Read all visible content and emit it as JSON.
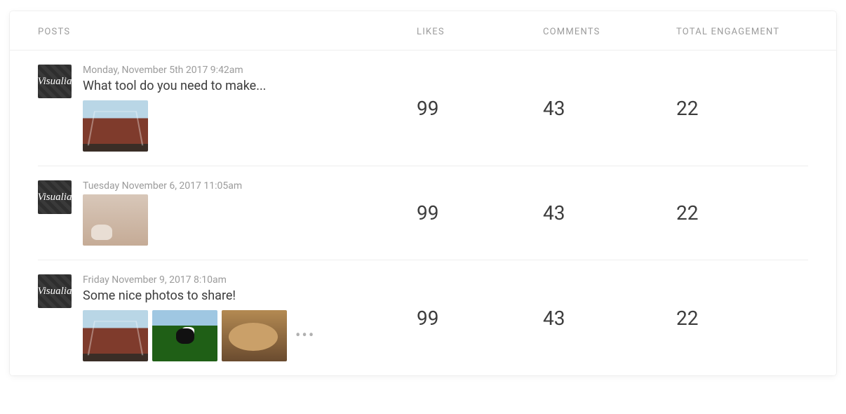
{
  "brand": "Visualia",
  "columns": {
    "posts": "POSTS",
    "likes": "LIKES",
    "comments": "COMMENTS",
    "total": "TOTAL ENGAGEMENT"
  },
  "rows": [
    {
      "timestamp": "Monday, November 5th 2017 9:42am",
      "title": "What tool do you need to make...",
      "thumbs": [
        "bridge"
      ],
      "more": false,
      "likes": "99",
      "comments": "43",
      "total": "22"
    },
    {
      "timestamp": "Tuesday November 6, 2017 11:05am",
      "title": "",
      "thumbs": [
        "cat"
      ],
      "more": false,
      "likes": "99",
      "comments": "43",
      "total": "22"
    },
    {
      "timestamp": "Friday November 9, 2017 8:10am",
      "title": "Some nice photos to share!",
      "thumbs": [
        "bridge",
        "field",
        "dog"
      ],
      "more": true,
      "likes": "99",
      "comments": "43",
      "total": "22"
    }
  ],
  "more_glyph": "•••"
}
